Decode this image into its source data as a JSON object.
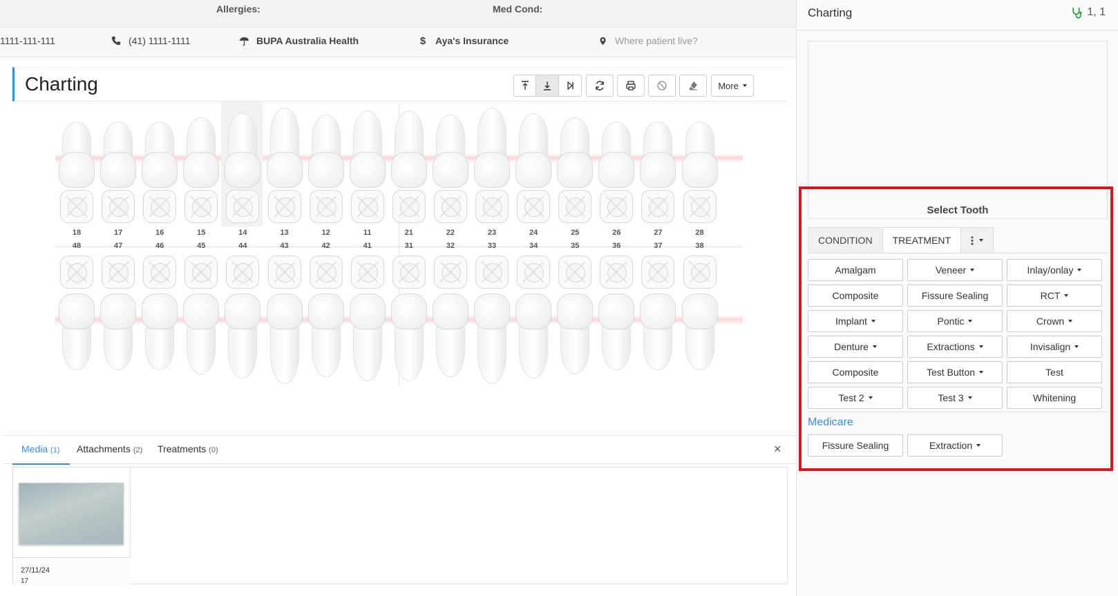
{
  "header": {
    "allergies_label": "Allergies:",
    "medcond_label": "Med Cond:",
    "id_text": "1111-111-111",
    "phone": "(41) 1111-1111",
    "fund": "BUPA Australia Health",
    "insurance": "Aya's Insurance",
    "address_placeholder": "Where patient live?"
  },
  "charting": {
    "title": "Charting",
    "more_label": "More",
    "upper_teeth": [
      "18",
      "17",
      "16",
      "15",
      "14",
      "13",
      "12",
      "11",
      "21",
      "22",
      "23",
      "24",
      "25",
      "26",
      "27",
      "28"
    ],
    "lower_teeth": [
      "48",
      "47",
      "46",
      "45",
      "44",
      "43",
      "42",
      "41",
      "31",
      "32",
      "33",
      "34",
      "35",
      "36",
      "37",
      "38"
    ],
    "selected_tooth": "14"
  },
  "bottom_tabs": {
    "media_label": "Media",
    "media_count": "(1)",
    "attachments_label": "Attachments",
    "attachments_count": "(2)",
    "treatments_label": "Treatments",
    "treatments_count": "(0)",
    "close": "×"
  },
  "media": {
    "date": "27/11/24",
    "date2": "17"
  },
  "panel": {
    "title": "Charting",
    "counter": "1, 1",
    "select_tooth": "Select Tooth",
    "tab_condition": "CONDITION",
    "tab_treatment": "TREATMENT",
    "treatment_buttons": [
      {
        "label": "Amalgam",
        "dropdown": false
      },
      {
        "label": "Veneer",
        "dropdown": true
      },
      {
        "label": "Inlay/onlay",
        "dropdown": true
      },
      {
        "label": "Composite",
        "dropdown": false
      },
      {
        "label": "Fissure Sealing",
        "dropdown": false
      },
      {
        "label": "RCT",
        "dropdown": true
      },
      {
        "label": "Implant",
        "dropdown": true
      },
      {
        "label": "Pontic",
        "dropdown": true
      },
      {
        "label": "Crown",
        "dropdown": true
      },
      {
        "label": "Denture",
        "dropdown": true
      },
      {
        "label": "Extractions",
        "dropdown": true
      },
      {
        "label": "Invisalign",
        "dropdown": true
      },
      {
        "label": "Composite",
        "dropdown": false
      },
      {
        "label": "Test Button",
        "dropdown": true
      },
      {
        "label": "Test",
        "dropdown": false
      },
      {
        "label": "Test 2",
        "dropdown": true
      },
      {
        "label": "Test 3",
        "dropdown": true
      },
      {
        "label": "Whitening",
        "dropdown": false
      }
    ],
    "medicare_label": "Medicare",
    "medicare_buttons": [
      {
        "label": "Fissure Sealing",
        "dropdown": false
      },
      {
        "label": "Extraction",
        "dropdown": true
      }
    ]
  },
  "colors": {
    "accent": "#3a8dde",
    "highlight": "#d9161c",
    "stethoscope": "#2e9b3e"
  }
}
